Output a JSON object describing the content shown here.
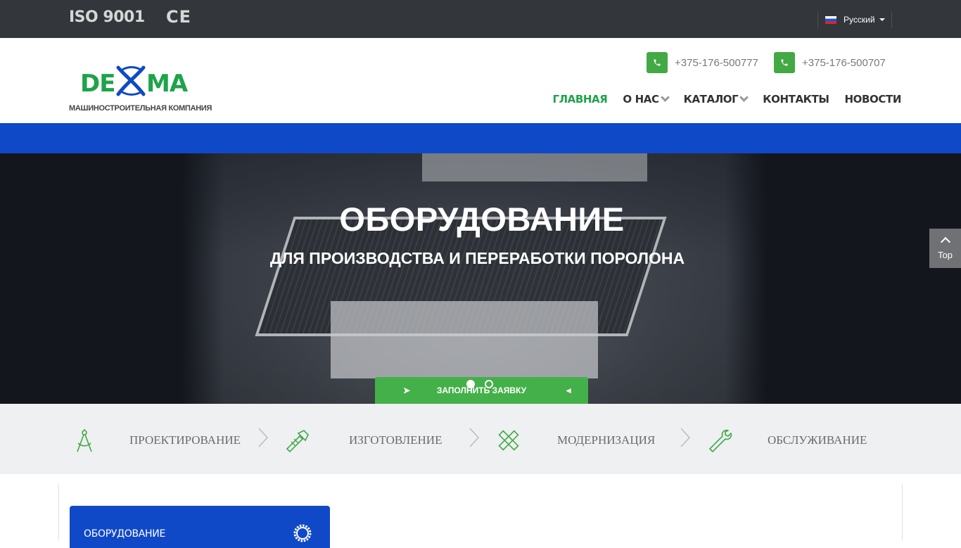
{
  "topbar": {
    "cert_iso": "ISO 9001",
    "cert_ce": "CE",
    "language": "Русский"
  },
  "header": {
    "logo_text": "DEXMA",
    "logo_subtitle": "МАШИНОСТРОИТЕЛЬНАЯ КОМПАНИЯ",
    "phones": [
      "+375-176-500777",
      "+375-176-500707"
    ],
    "nav": [
      {
        "label": "ГЛАВНАЯ",
        "active": true
      },
      {
        "label": "О НАС",
        "dropdown": true
      },
      {
        "label": "КАТАЛОГ",
        "dropdown": true
      },
      {
        "label": "КОНТАКТЫ"
      },
      {
        "label": "НОВОСТИ"
      }
    ]
  },
  "hero": {
    "title": "ОБОРУДОВАНИЕ",
    "subtitle": "ДЛЯ ПРОИЗВОДСТВА И ПЕРЕРАБОТКИ ПОРОЛОНА",
    "cta_label": "ЗАПОЛНИТЬ ЗАЯВКУ",
    "slides": 2,
    "active_slide": 1
  },
  "to_top_label": "Top",
  "services": [
    {
      "label": "ПРОЕКТИРОВАНИЕ",
      "icon": "compass-icon"
    },
    {
      "label": "ИЗГОТОВЛЕНИЕ",
      "icon": "tools-icon"
    },
    {
      "label": "МОДЕРНИЗАЦИЯ",
      "icon": "pencil-ruler-icon"
    },
    {
      "label": "ОБСЛУЖИВАНИЕ",
      "icon": "wrench-icon"
    }
  ],
  "catalog_card": {
    "title": "ОБОРУДОВАНИЕ",
    "icon": "gear-icon"
  },
  "colors": {
    "accent_green": "#1ea34a",
    "brand_blue": "#1049c7",
    "topbar": "#33363b"
  }
}
